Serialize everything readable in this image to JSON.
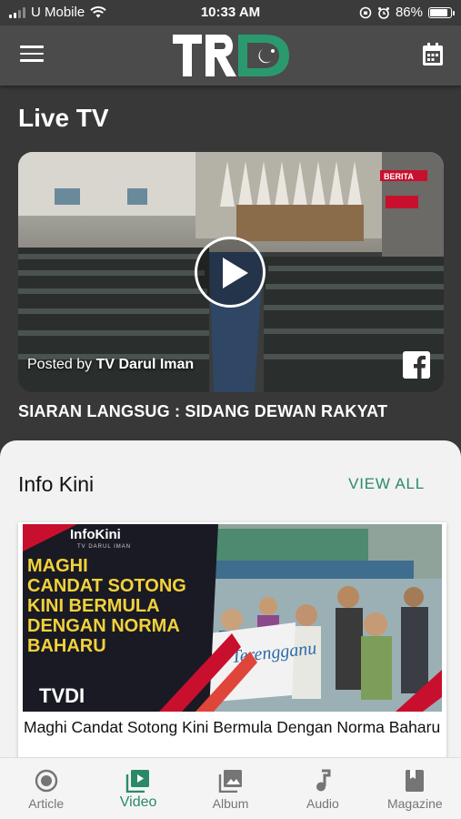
{
  "status_bar": {
    "carrier": "U Mobile",
    "time": "10:33 AM",
    "battery": "86%",
    "battery_level": 0.86
  },
  "header": {
    "logo_text": "TRDI"
  },
  "live_tv": {
    "section_title": "Live TV",
    "posted_prefix": "Posted by",
    "posted_by": "TV Darul Iman",
    "caption": "SIARAN LANGSUG : SIDANG DEWAN RAKYAT",
    "overlay_badge": "BERITA"
  },
  "info_kini": {
    "section_title": "Info Kini",
    "view_all_label": "VIEW ALL",
    "card": {
      "brand": "InfoKini",
      "brand_sub": "TV DARUL IMAN",
      "image_text_lines": [
        "MAGHI",
        "CANDAT SOTONG",
        "KINI BERMULA",
        "DENGAN NORMA",
        "BAHARU"
      ],
      "logo_text": "TVDI",
      "banner_text": "Terengganu",
      "headline": "Maghi Candat Sotong Kini Bermula Dengan Norma Baharu"
    }
  },
  "bottom_nav": {
    "items": [
      {
        "label": "Article",
        "icon": "article-icon"
      },
      {
        "label": "Video",
        "icon": "video-icon"
      },
      {
        "label": "Album",
        "icon": "album-icon"
      },
      {
        "label": "Audio",
        "icon": "audio-icon"
      },
      {
        "label": "Magazine",
        "icon": "magazine-icon"
      }
    ],
    "active_index": 1
  },
  "colors": {
    "accent": "#2a8a68",
    "header_bg": "#4b4b4b",
    "body_bg": "#383838",
    "card_yellow": "#f2d23a"
  }
}
